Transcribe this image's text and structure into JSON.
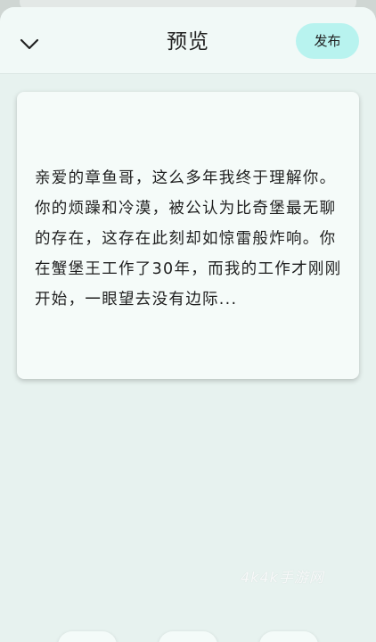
{
  "header": {
    "title": "预览",
    "publish_label": "发布",
    "close_icon": "chevron-down-icon"
  },
  "card": {
    "text": "亲爱的章鱼哥，这么多年我终于理解你。你的烦躁和冷漠，被公认为比奇堡最无聊的存在，这存在此刻却如惊雷般炸响。你在蟹堡王工作了30年，而我的工作才刚刚开始，一眼望去没有边际..."
  },
  "watermark": {
    "text": "4k4k手游网"
  },
  "colors": {
    "sheet_bg": "#e7f2ef",
    "header_bg": "#f1f9f7",
    "publish_bg": "#b8f3ef",
    "card_bg": "#f5fbf9"
  }
}
